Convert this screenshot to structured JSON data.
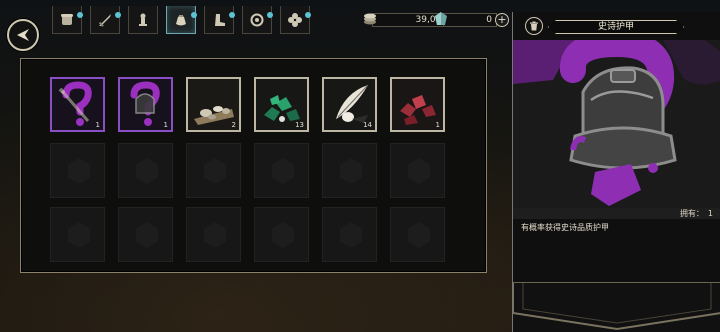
{
  "header": {
    "tabs": [
      {
        "icon": "scroll-icon",
        "active": false,
        "badge": true
      },
      {
        "icon": "sword-icon",
        "active": false,
        "badge": true
      },
      {
        "icon": "chess-piece-icon",
        "active": false,
        "badge": false
      },
      {
        "icon": "pouch-icon",
        "active": true,
        "badge": true
      },
      {
        "icon": "boot-icon",
        "active": false,
        "badge": true
      },
      {
        "icon": "ring-icon",
        "active": false,
        "badge": true
      },
      {
        "icon": "clover-gem-icon",
        "active": false,
        "badge": true
      }
    ],
    "currency": {
      "gold": "39,010",
      "shards": "0"
    }
  },
  "inventory": {
    "rows": 3,
    "cols": 6,
    "items": [
      {
        "name": "mystery-epic-weapon",
        "qty": "1",
        "rarity": "epic",
        "color": "#8a4fc4"
      },
      {
        "name": "mystery-epic-armor",
        "qty": "1",
        "rarity": "epic",
        "color": "#8a4fc4"
      },
      {
        "name": "bone-scraps",
        "qty": "2",
        "rarity": "common",
        "color": "#bdb6a2"
      },
      {
        "name": "green-gems",
        "qty": "13",
        "rarity": "common",
        "color": "#bdb6a2"
      },
      {
        "name": "white-feather",
        "qty": "14",
        "rarity": "common",
        "color": "#bdb6a2"
      },
      {
        "name": "red-gems",
        "qty": "1",
        "rarity": "common",
        "color": "#bdb6a2"
      }
    ]
  },
  "detail": {
    "title": "史诗护甲",
    "owned_label": "拥有：",
    "owned_count": "1",
    "description": "有概率获得史诗品质护甲",
    "accent": "#8e2fb3"
  }
}
